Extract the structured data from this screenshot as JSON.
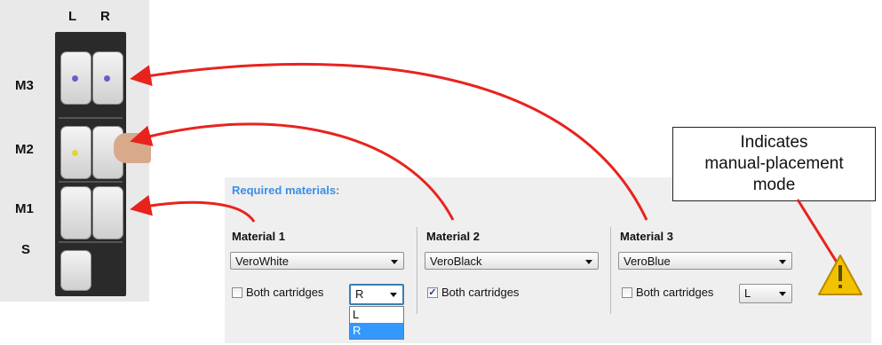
{
  "cabinet": {
    "col_left": "L",
    "col_right": "R",
    "rows": [
      "M3",
      "M2",
      "M1",
      "S"
    ]
  },
  "panel": {
    "title": "Required materials:",
    "materials": [
      {
        "label": "Material 1",
        "value": "VeroWhite",
        "both_label": "Both cartridges",
        "both_checked": false,
        "side": "R"
      },
      {
        "label": "Material 2",
        "value": "VeroBlack",
        "both_label": "Both cartridges",
        "both_checked": true
      },
      {
        "label": "Material 3",
        "value": "VeroBlue",
        "both_label": "Both cartridges",
        "both_checked": false,
        "side": "L"
      }
    ],
    "side_dropdown": {
      "options": [
        "L",
        "R"
      ],
      "selected": "R"
    }
  },
  "callout": {
    "lines": [
      "Indicates",
      "manual-placement",
      "mode"
    ]
  },
  "colors": {
    "arrow": "#e8231e",
    "accent": "#3a8ee6",
    "warning": "#f2c200",
    "selection": "#3399ff"
  },
  "icons": [
    "warning-icon",
    "checkbox-checked-icon",
    "chevron-down-icon"
  ]
}
